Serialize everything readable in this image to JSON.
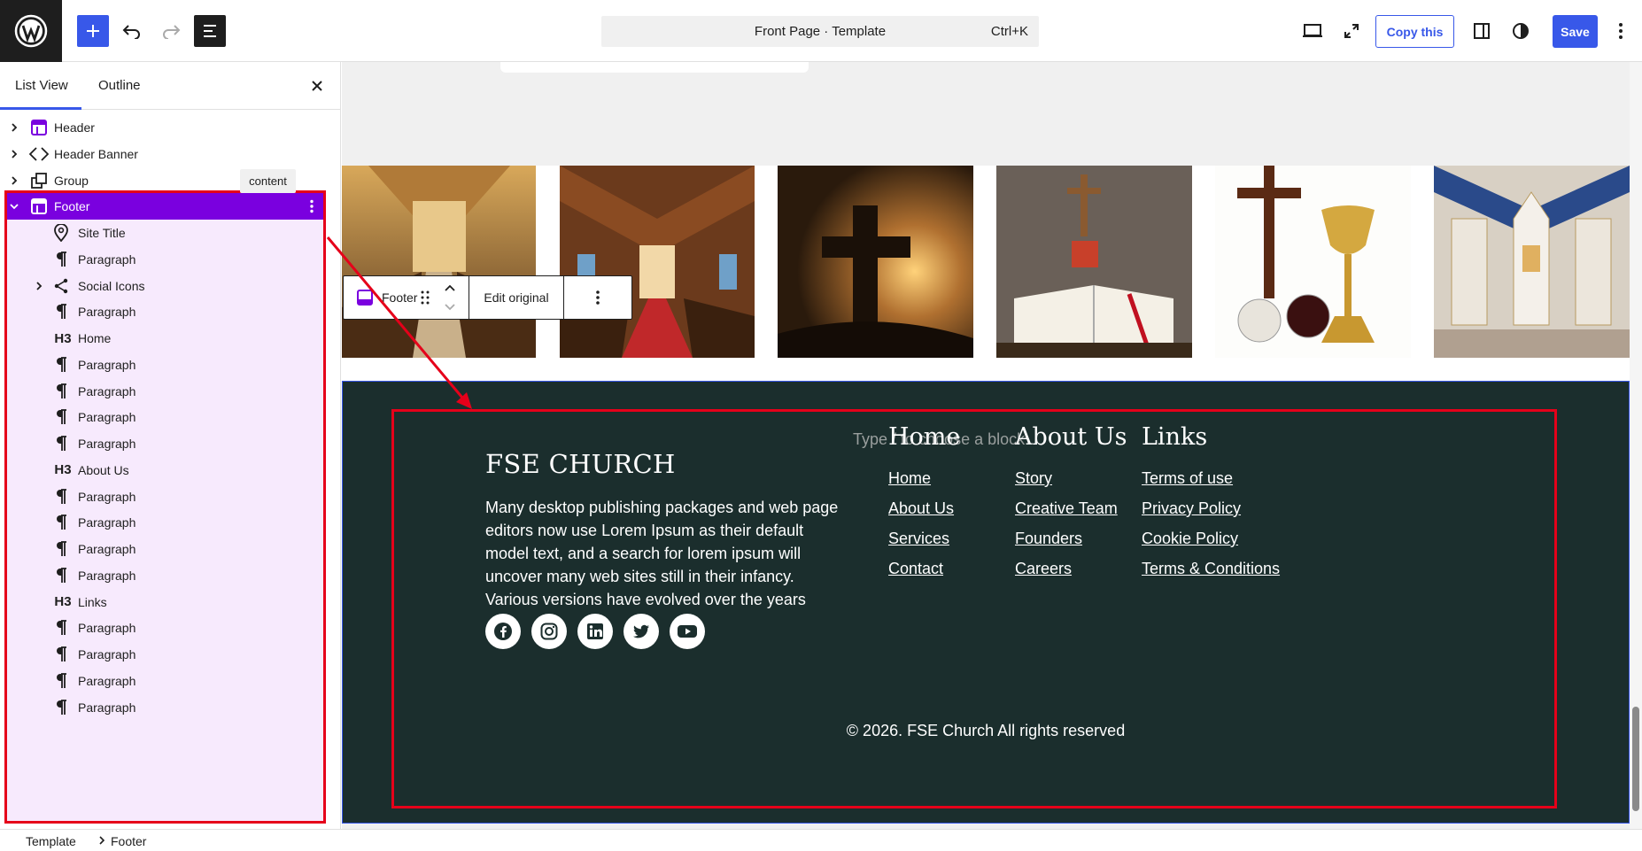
{
  "topbar": {
    "template_title": "Front Page · Template",
    "shortcut": "Ctrl+K",
    "copy_label": "Copy this",
    "save_label": "Save"
  },
  "sidebar": {
    "tabs": [
      "List View",
      "Outline"
    ],
    "tooltip": "content",
    "items": [
      {
        "label": "Header",
        "icon": "template-part-icon",
        "level": 0,
        "expandable": true
      },
      {
        "label": "Header Banner",
        "icon": "reusable-block-icon",
        "level": 0,
        "expandable": true
      },
      {
        "label": "Group",
        "icon": "group-icon",
        "level": 0,
        "expandable": true
      },
      {
        "label": "Footer",
        "icon": "template-part-icon",
        "level": 0,
        "expandable": true,
        "selected": true
      },
      {
        "label": "Site Title",
        "icon": "map-pin-icon",
        "level": 1
      },
      {
        "label": "Paragraph",
        "icon": "paragraph-icon",
        "level": 1
      },
      {
        "label": "Social Icons",
        "icon": "share-icon",
        "level": 1,
        "expandable": true
      },
      {
        "label": "Paragraph",
        "icon": "paragraph-icon",
        "level": 1
      },
      {
        "label": "Home",
        "icon": "h3",
        "level": 1
      },
      {
        "label": "Paragraph",
        "icon": "paragraph-icon",
        "level": 1
      },
      {
        "label": "Paragraph",
        "icon": "paragraph-icon",
        "level": 1
      },
      {
        "label": "Paragraph",
        "icon": "paragraph-icon",
        "level": 1
      },
      {
        "label": "Paragraph",
        "icon": "paragraph-icon",
        "level": 1
      },
      {
        "label": "About Us",
        "icon": "h3",
        "level": 1
      },
      {
        "label": "Paragraph",
        "icon": "paragraph-icon",
        "level": 1
      },
      {
        "label": "Paragraph",
        "icon": "paragraph-icon",
        "level": 1
      },
      {
        "label": "Paragraph",
        "icon": "paragraph-icon",
        "level": 1
      },
      {
        "label": "Paragraph",
        "icon": "paragraph-icon",
        "level": 1
      },
      {
        "label": "Links",
        "icon": "h3",
        "level": 1
      },
      {
        "label": "Paragraph",
        "icon": "paragraph-icon",
        "level": 1
      },
      {
        "label": "Paragraph",
        "icon": "paragraph-icon",
        "level": 1
      },
      {
        "label": "Paragraph",
        "icon": "paragraph-icon",
        "level": 1
      },
      {
        "label": "Paragraph",
        "icon": "paragraph-icon",
        "level": 1
      }
    ],
    "h3_tag": "H3"
  },
  "breadcrumb": {
    "root": "Template",
    "current": "Footer"
  },
  "block_toolbar": {
    "block_name": "Footer",
    "edit_label": "Edit original"
  },
  "footer": {
    "site_title": "FSE CHURCH",
    "description": "Many desktop publishing packages and web page editors now use Lorem Ipsum as their default model text, and a search for lorem ipsum will uncover many web sites still in their infancy. Various versions have evolved over the years",
    "placeholder": "Type / to choose a block",
    "columns": [
      {
        "heading": "Home",
        "links": [
          "Home",
          "About Us",
          "Services",
          "Contact"
        ]
      },
      {
        "heading": "About Us",
        "links": [
          "Story",
          "Creative Team",
          "Founders",
          "Careers"
        ]
      },
      {
        "heading": "Links",
        "links": [
          "Terms of use",
          "Privacy Policy",
          "Cookie Policy",
          "Terms & Conditions"
        ]
      }
    ],
    "socials": [
      "facebook-icon",
      "instagram-icon",
      "linkedin-icon",
      "twitter-icon",
      "youtube-icon"
    ],
    "copyright": "© 2026. FSE Church All rights reserved"
  },
  "colors": {
    "accent": "#3858e9",
    "selected": "#7a00df",
    "footer_bg": "#1b2e2d",
    "highlight": "#e5001a"
  }
}
